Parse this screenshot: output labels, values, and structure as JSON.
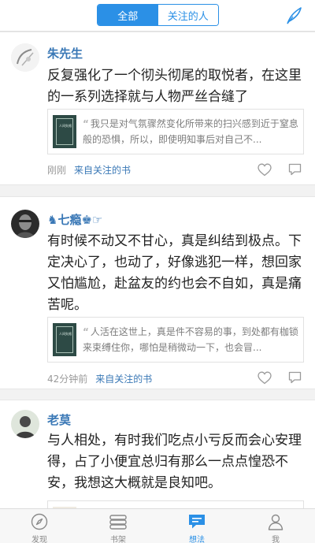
{
  "header": {
    "tabs": [
      "全部",
      "关注的人"
    ],
    "active_tab": 0
  },
  "posts": [
    {
      "user": "朱先生",
      "text": "反复强化了一个彻头彻尾的取悦者，在这里的一系列选择就与人物严丝合缝了",
      "quote": "我只是对气氛骤然变化所带来的扫兴感到近于窒息般的恐惧，所以，即使明知事后对自己不...",
      "time": "刚刚",
      "source": "来自关注的书"
    },
    {
      "user": "♞七瘾♚☞",
      "text": "有时候不动又不甘心，真是纠结到极点。下定决心了，也动了，好像逃犯一样，想回家又怕尴尬，赴盆友的约也会不自如，真是痛苦呢。",
      "quote": "人活在这世上，真是件不容易的事，到处都有枷锁来束缚住你，哪怕是稍微动一下，也会冒...",
      "time": "42分钟前",
      "source": "来自关注的书"
    },
    {
      "user": "老莫",
      "text": "与人相处，有时我们吃点小亏反而会心安理得，占了小便宜总归有那么一点点惶恐不安，我想这大概就是良知吧。",
      "quote": "",
      "time": "",
      "source": ""
    }
  ],
  "book_cover_text": "人间失格",
  "tabbar": {
    "items": [
      "发现",
      "书架",
      "想法",
      "我"
    ],
    "active": 2
  },
  "colors": {
    "accent": "#2b90e6",
    "username": "#3a78b6"
  }
}
